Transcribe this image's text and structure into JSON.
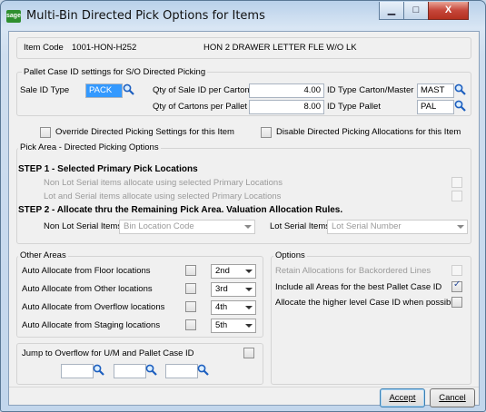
{
  "window": {
    "app_icon_text": "sage",
    "title": "Multi-Bin Directed Pick Options for Items",
    "min_label": "▁",
    "max_label": "□",
    "close_label": "X"
  },
  "item": {
    "code_label": "Item Code",
    "code_value": "1001-HON-H252",
    "description": "HON 2 DRAWER LETTER FLE W/O LK"
  },
  "pallet_case": {
    "group_title": "Pallet Case ID settings for S/O Directed Picking",
    "sale_id_type_label": "Sale ID Type",
    "sale_id_type_value": "PACK",
    "qty_sale_id_per_carton_label": "Qty of Sale ID per Carton",
    "qty_sale_id_per_carton_value": "4.00",
    "qty_cartons_per_pallet_label": "Qty of Cartons per Pallet",
    "qty_cartons_per_pallet_value": "8.00",
    "id_type_carton_label": "ID Type Carton/Master",
    "id_type_carton_value": "MAST",
    "id_type_pallet_label": "ID Type Pallet",
    "id_type_pallet_value": "PAL"
  },
  "override_label": "Override Directed Picking Settings for this Item",
  "disable_label": "Disable Directed Picking Allocations for this Item",
  "pick_area": {
    "group_title": "Pick Area - Directed Picking Options",
    "step1_title": "STEP 1 - Selected Primary Pick Locations",
    "non_lot_label": "Non Lot Serial items allocate using selected Primary Locations",
    "lot_label": "Lot and Serial items allocate using selected Primary Locations",
    "step2_title": "STEP 2 - Allocate thru the Remaining Pick Area.  Valuation Allocation Rules.",
    "non_lot_items_label": "Non Lot Serial Items",
    "non_lot_items_value": "Bin Location Code",
    "lot_items_label": "Lot Serial Items",
    "lot_items_value": "Lot Serial Number"
  },
  "other_areas": {
    "group_title": "Other Areas",
    "rows": [
      {
        "label": "Auto Allocate from Floor locations",
        "value": "2nd"
      },
      {
        "label": "Auto Allocate from Other locations",
        "value": "3rd"
      },
      {
        "label": "Auto Allocate from Overflow locations",
        "value": "4th"
      },
      {
        "label": "Auto Allocate from Staging locations",
        "value": "5th"
      }
    ]
  },
  "jump": {
    "label": "Jump to Overflow for U/M and Pallet Case ID"
  },
  "options": {
    "group_title": "Options",
    "retain_label": "Retain Allocations for Backordered Lines",
    "include_label": "Include all Areas for the best Pallet Case ID",
    "higher_label": "Allocate the higher level Case ID when possible"
  },
  "buttons": {
    "accept": "Accept",
    "cancel": "Cancel"
  },
  "colors": {
    "selection": "#3399ff",
    "title_bar": "#b9d1ea",
    "close_button": "#c6463a"
  }
}
